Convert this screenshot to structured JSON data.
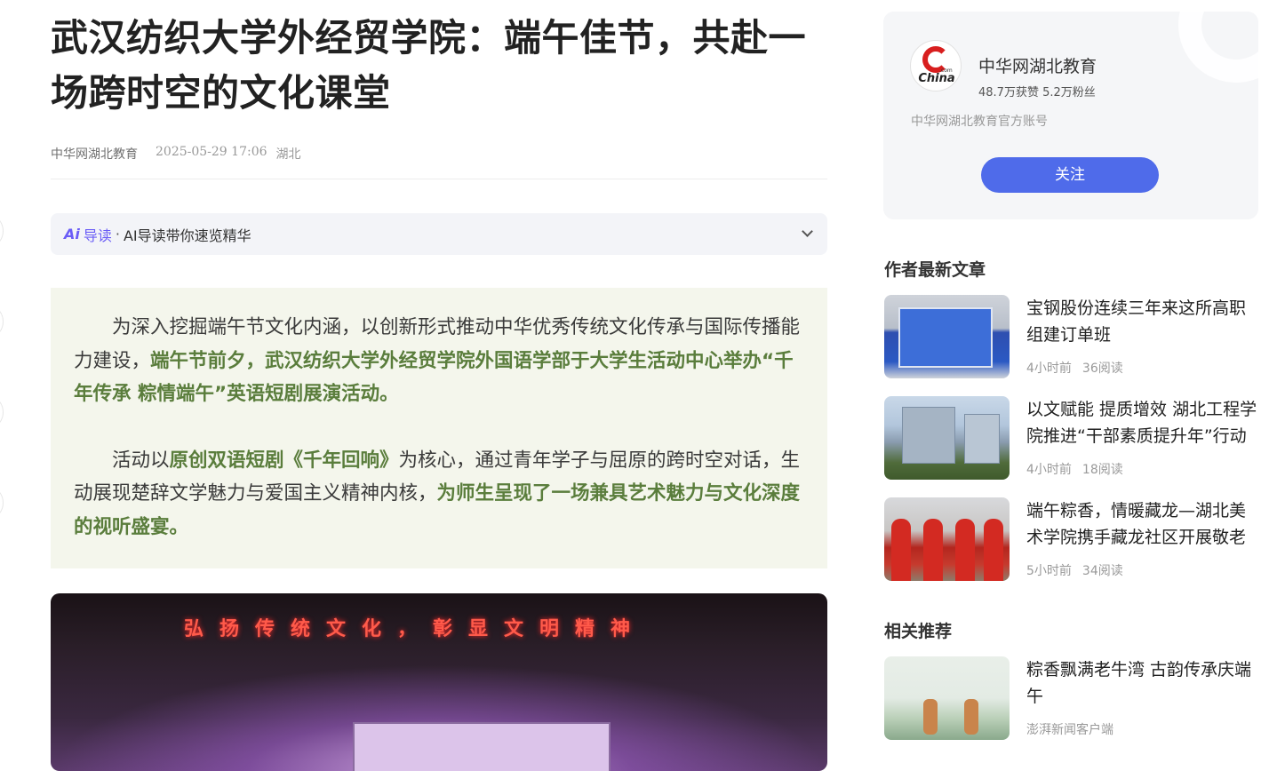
{
  "article": {
    "title": "武汉纺织大学外经贸学院：端午佳节，共赴一场跨时空的文化课堂",
    "author": "中华网湖北教育",
    "datetime": "2025-05-29 17:06",
    "location": "湖北"
  },
  "ai_guide": {
    "logo": "Ai",
    "tag": "导读",
    "dot": "·",
    "description": "AI导读带你速览精华"
  },
  "quote": {
    "p1_a": "为深入挖掘端午节文化内涵，以创新形式推动中华优秀传统文化传承与国际传播能力建设，",
    "p1_b": "端午节前夕，武汉纺织大学外经贸学院外国语学部于大学生活动中心举办“千年传承 粽情端午”英语短剧展演活动。",
    "p2_a": "活动以",
    "p2_b": "原创双语短剧《千年回响》",
    "p2_c": "为核心，通过青年学子与屈原的跨时空对话，生动展现楚辞文学魅力与爱国主义精神内核，",
    "p2_d": "为师生呈现了一场兼具艺术魅力与文化深度的视听盛宴。"
  },
  "photo": {
    "banner": "弘扬传统文化，彰显文明精神"
  },
  "author_card": {
    "logo_text": "China",
    "logo_dotcom": ".com",
    "name": "中华网湖北教育",
    "stats": "48.7万获赞 5.2万粉丝",
    "description": "中华网湖北教育官方账号",
    "follow_label": "关注"
  },
  "latest": {
    "heading": "作者最新文章",
    "items": [
      {
        "title": "宝钢股份连续三年来这所高职组建订单班",
        "time": "4小时前",
        "reads": "36阅读"
      },
      {
        "title": "以文赋能 提质增效 湖北工程学院推进“干部素质提升年”行动",
        "time": "4小时前",
        "reads": "18阅读"
      },
      {
        "title": "端午粽香，情暖藏龙—湖北美术学院携手藏龙社区开展敬老活动",
        "time": "5小时前",
        "reads": "34阅读"
      }
    ]
  },
  "related": {
    "heading": "相关推荐",
    "items": [
      {
        "title": "粽香飘满老牛湾 古韵传承庆端午",
        "source": "澎湃新闻客户端"
      }
    ]
  }
}
